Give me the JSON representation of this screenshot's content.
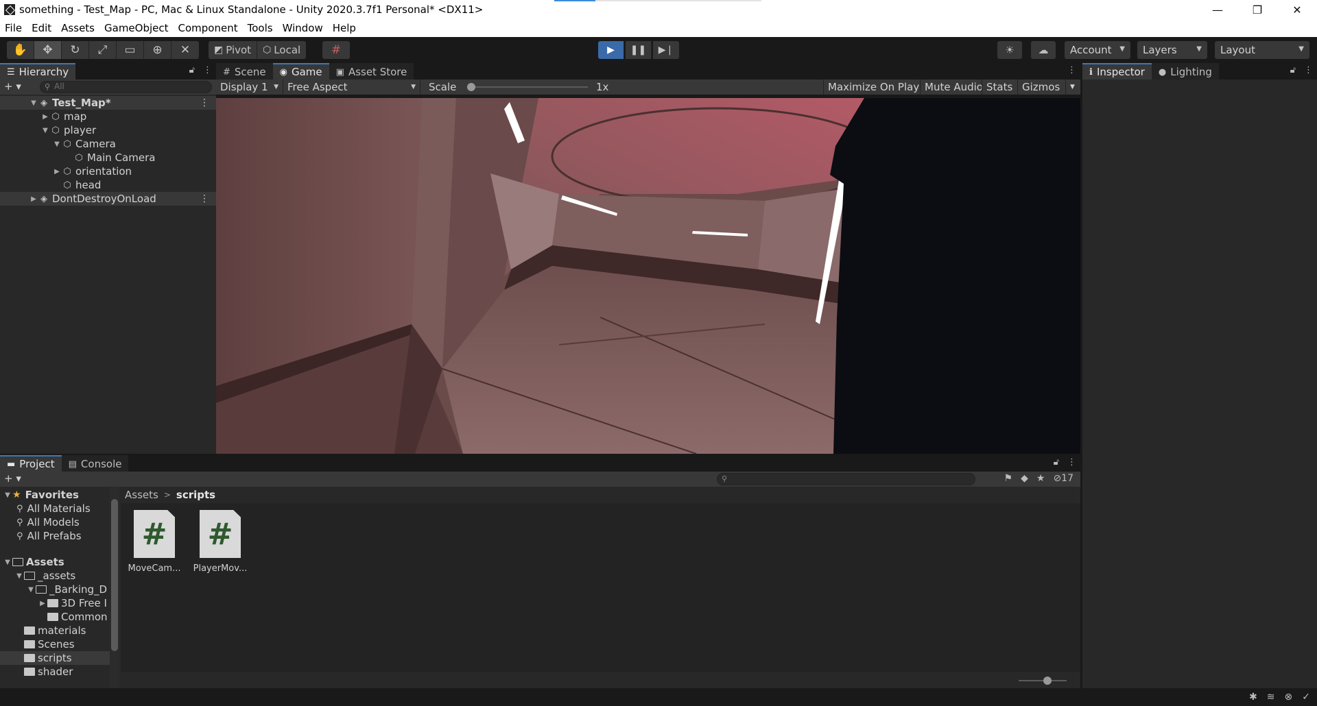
{
  "window": {
    "title": "something - Test_Map - PC, Mac & Linux Standalone - Unity 2020.3.7f1 Personal* <DX11>",
    "controls": {
      "minimize": "—",
      "maximize": "❐",
      "close": "✕"
    }
  },
  "menu": [
    "File",
    "Edit",
    "Assets",
    "GameObject",
    "Component",
    "Tools",
    "Window",
    "Help"
  ],
  "toolbar": {
    "pivot_label": "Pivot",
    "local_label": "Local",
    "account_label": "Account",
    "layers_label": "Layers",
    "layout_label": "Layout",
    "playing": true
  },
  "hierarchy": {
    "tab_label": "Hierarchy",
    "search_placeholder": "All",
    "items": [
      {
        "label": "Test_Map*",
        "depth": 0,
        "expanded": true,
        "type": "scene"
      },
      {
        "label": "map",
        "depth": 1,
        "expanded": false,
        "type": "object"
      },
      {
        "label": "player",
        "depth": 1,
        "expanded": true,
        "type": "object"
      },
      {
        "label": "Camera",
        "depth": 2,
        "expanded": true,
        "type": "object"
      },
      {
        "label": "Main Camera",
        "depth": 3,
        "type": "object"
      },
      {
        "label": "orientation",
        "depth": 2,
        "expanded": false,
        "type": "object"
      },
      {
        "label": "head",
        "depth": 2,
        "type": "object"
      },
      {
        "label": "DontDestroyOnLoad",
        "depth": 0,
        "expanded": false,
        "type": "scene"
      }
    ]
  },
  "game": {
    "tabs": [
      {
        "label": "Scene",
        "active": false
      },
      {
        "label": "Game",
        "active": true
      },
      {
        "label": "Asset Store",
        "active": false
      }
    ],
    "display": "Display 1",
    "aspect": "Free Aspect",
    "scale_label": "Scale",
    "scale_value": "1x",
    "buttons": [
      "Maximize On Play",
      "Mute Audio",
      "Stats",
      "Gizmos"
    ]
  },
  "inspector": {
    "tabs": [
      {
        "label": "Inspector",
        "active": true
      },
      {
        "label": "Lighting",
        "active": false
      }
    ]
  },
  "project": {
    "tabs": [
      {
        "label": "Project",
        "active": true
      },
      {
        "label": "Console",
        "active": false
      }
    ],
    "hidden_count": "17",
    "favorites_label": "Favorites",
    "favorites": [
      "All Materials",
      "All Models",
      "All Prefabs"
    ],
    "assets_label": "Assets",
    "tree": [
      {
        "label": "_assets",
        "depth": 1,
        "expanded": true
      },
      {
        "label": "_Barking_D",
        "depth": 2,
        "expanded": true
      },
      {
        "label": "3D Free I",
        "depth": 3,
        "expanded": false
      },
      {
        "label": "Common",
        "depth": 3
      },
      {
        "label": "materials",
        "depth": 1
      },
      {
        "label": "Scenes",
        "depth": 1
      },
      {
        "label": "scripts",
        "depth": 1,
        "selected": true
      },
      {
        "label": "shader",
        "depth": 1
      }
    ],
    "breadcrumb": [
      "Assets",
      "scripts"
    ],
    "files": [
      {
        "name": "MoveCam...",
        "glyph": "#"
      },
      {
        "name": "PlayerMov...",
        "glyph": "#"
      }
    ]
  },
  "colors": {
    "accent": "#3a79bb",
    "play_active": "#3a6aa8",
    "panel_bg": "#282828",
    "favorite_star": "#f0b23a"
  }
}
